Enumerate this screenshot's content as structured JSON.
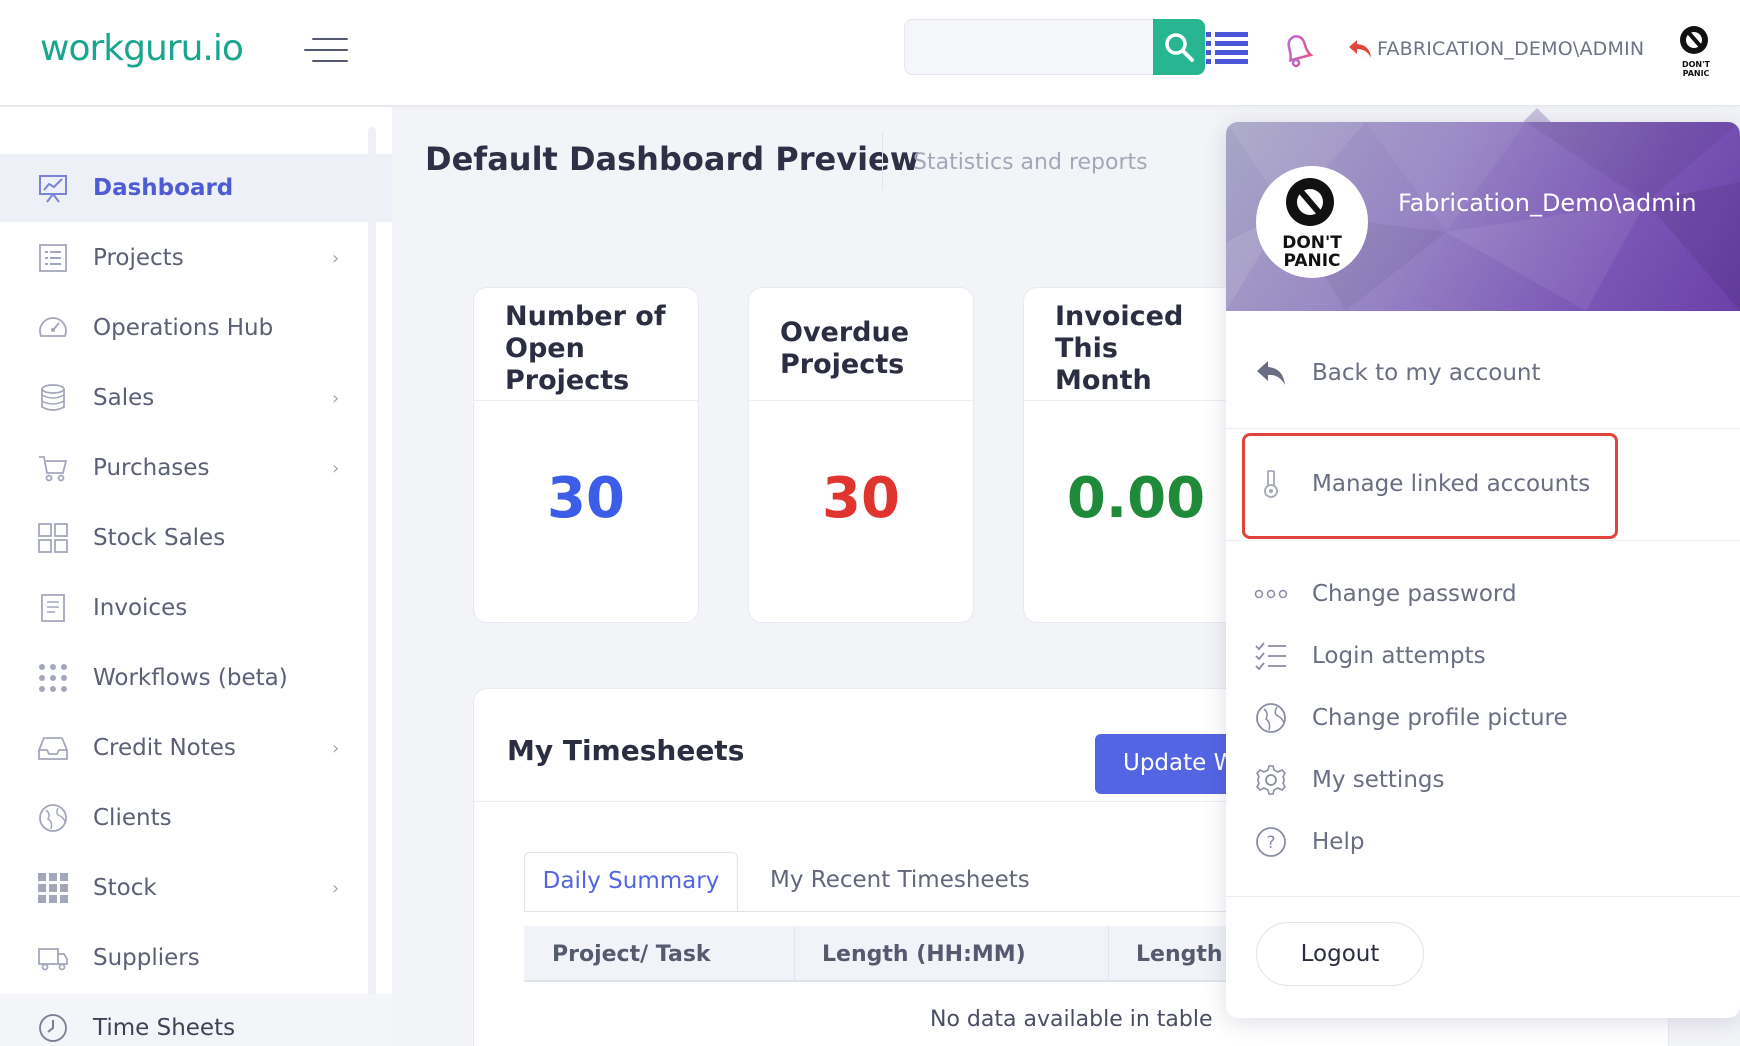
{
  "header": {
    "logo": "workguru.io",
    "search_placeholder": "",
    "user_label": "FABRICATION_DEMO\\ADMIN",
    "icons": [
      "hamburger-icon",
      "search-icon",
      "list-icon",
      "bell-icon",
      "back-arrow-icon",
      "avatar"
    ]
  },
  "sidebar": {
    "items": [
      {
        "label": "Dashboard",
        "icon": "chart-board-icon"
      },
      {
        "label": "Projects",
        "icon": "list-icon"
      },
      {
        "label": "Operations Hub",
        "icon": "gauge-icon"
      },
      {
        "label": "Sales",
        "icon": "coins-icon"
      },
      {
        "label": "Purchases",
        "icon": "cart-icon"
      },
      {
        "label": "Stock Sales",
        "icon": "grid-icon"
      },
      {
        "label": "Invoices",
        "icon": "invoice-icon"
      },
      {
        "label": "Workflows (beta)",
        "icon": "dots-grid-icon"
      },
      {
        "label": "Credit Notes",
        "icon": "inbox-icon"
      },
      {
        "label": "Clients",
        "icon": "globe-icon"
      },
      {
        "label": "Stock",
        "icon": "stock-grid-icon"
      },
      {
        "label": "Suppliers",
        "icon": "truck-icon"
      },
      {
        "label": "Time Sheets",
        "icon": "clock-icon"
      }
    ],
    "chevron": "›",
    "active": "Dashboard"
  },
  "main": {
    "title": "Default Dashboard Preview",
    "subtitle": "Statistics and reports",
    "stats": [
      {
        "title": "Number of Open Projects",
        "value": "30",
        "color": "#3b5de7"
      },
      {
        "title": "Overdue Projects",
        "value": "30",
        "color": "#e0342f"
      },
      {
        "title": "Invoiced This Month",
        "value": "0.00",
        "color": "#1f8a3a"
      }
    ],
    "timesheets": {
      "title": "My Timesheets",
      "update_button": "Update Weekly Timesheet",
      "tabs": [
        "Daily Summary",
        "My Recent Timesheets"
      ],
      "columns": [
        "Project/ Task",
        "Length (HH:MM)",
        "Length ("
      ],
      "empty": "No data available in table"
    }
  },
  "dropdown": {
    "username": "Fabrication_Demo\\admin",
    "avatar_text": [
      "DON'T",
      "PANIC"
    ],
    "items": [
      {
        "label": "Back to my account",
        "icon": "reply-icon"
      },
      {
        "label": "Manage linked accounts",
        "icon": "link-accounts-icon"
      },
      {
        "label": "Change password",
        "icon": "password-dots-icon"
      },
      {
        "label": "Login attempts",
        "icon": "checklist-icon"
      },
      {
        "label": "Change profile picture",
        "icon": "profile-picture-icon"
      },
      {
        "label": "My settings",
        "icon": "gear-icon"
      },
      {
        "label": "Help",
        "icon": "help-icon"
      }
    ],
    "logout": "Logout"
  },
  "colors": {
    "accent": "#5465e3",
    "brand": "#1aa58f",
    "highlight": "#e0443a"
  }
}
